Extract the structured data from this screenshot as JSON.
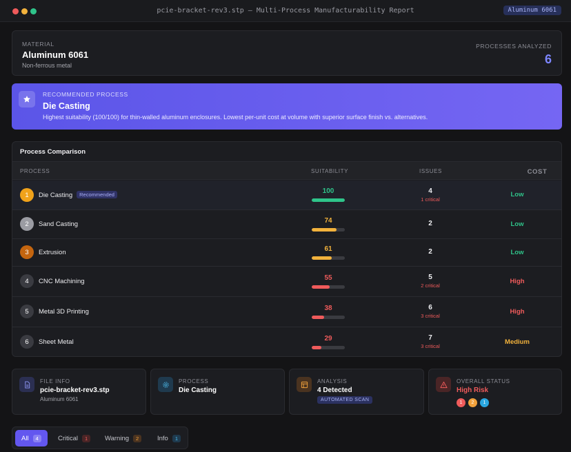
{
  "window": {
    "title": "pcie-bracket-rev3.stp — Multi-Process Manufacturability Report",
    "material_chip": "Aluminum 6061"
  },
  "material": {
    "label": "MATERIAL",
    "name": "Aluminum 6061",
    "category": "Non-ferrous metal",
    "processes_label": "PROCESSES ANALYZED",
    "processes_count": "6"
  },
  "recommendation": {
    "icon": "star-icon",
    "label": "RECOMMENDED PROCESS",
    "name": "Die Casting",
    "description": "Highest suitability (100/100) for thin-walled aluminum enclosures. Lowest per-unit cost at volume with superior surface finish vs. alternatives."
  },
  "table": {
    "title": "Process Comparison",
    "headers": {
      "process": "PROCESS",
      "suitability": "SUITABILITY",
      "issues": "ISSUES",
      "cost": "COST"
    },
    "recommended_badge": "Recommended",
    "rows": [
      {
        "rank": "1",
        "name": "Die Casting",
        "score": 100,
        "score_text": "100",
        "issues": "4",
        "critical": "1 critical",
        "cost": "Low",
        "rank_color": "#f0a21a",
        "score_color": "#2fc48a",
        "cost_color": "#2fc48a"
      },
      {
        "rank": "2",
        "name": "Sand Casting",
        "score": 74,
        "score_text": "74",
        "issues": "2",
        "critical": "",
        "cost": "Low",
        "rank_color": "#9b9ca3",
        "score_color": "#f2b23c",
        "cost_color": "#2fc48a"
      },
      {
        "rank": "3",
        "name": "Extrusion",
        "score": 61,
        "score_text": "61",
        "issues": "2",
        "critical": "",
        "cost": "Low",
        "rank_color": "#c4650f",
        "score_color": "#f2b23c",
        "cost_color": "#2fc48a"
      },
      {
        "rank": "4",
        "name": "CNC Machining",
        "score": 55,
        "score_text": "55",
        "issues": "5",
        "critical": "2 critical",
        "cost": "High",
        "rank_color": "#3a3b41",
        "score_color": "#ef5b5b",
        "cost_color": "#ef5b5b"
      },
      {
        "rank": "5",
        "name": "Metal 3D Printing",
        "score": 38,
        "score_text": "38",
        "issues": "6",
        "critical": "3 critical",
        "cost": "High",
        "rank_color": "#3a3b41",
        "score_color": "#ef5b5b",
        "cost_color": "#ef5b5b"
      },
      {
        "rank": "6",
        "name": "Sheet Metal",
        "score": 29,
        "score_text": "29",
        "issues": "7",
        "critical": "3 critical",
        "cost": "Medium",
        "rank_color": "#3a3b41",
        "score_color": "#ef5b5b",
        "cost_color": "#f2b23c"
      }
    ]
  },
  "summary": {
    "file": {
      "icon": "document-icon",
      "label": "FILE INFO",
      "value": "pcie-bracket-rev3.stp",
      "sub": "Aluminum 6061"
    },
    "process": {
      "icon": "gear-icon",
      "label": "PROCESS",
      "value": "Die Casting"
    },
    "analysis": {
      "icon": "grid-icon",
      "label": "ANALYSIS",
      "value": "4 Detected",
      "badge": "AUTOMATED SCAN"
    },
    "status": {
      "icon": "warning-icon",
      "label": "OVERALL STATUS",
      "value": "High Risk",
      "critical": "1",
      "warning": "2",
      "info": "1"
    }
  },
  "filters": [
    {
      "label": "All",
      "count": "4"
    },
    {
      "label": "Critical",
      "count": "1"
    },
    {
      "label": "Warning",
      "count": "2"
    },
    {
      "label": "Info",
      "count": "1"
    }
  ],
  "colors": {
    "accent": "#6357ef",
    "success": "#2fc48a",
    "warning": "#f2b23c",
    "danger": "#ef5b5b",
    "info": "#2aa7e0"
  }
}
